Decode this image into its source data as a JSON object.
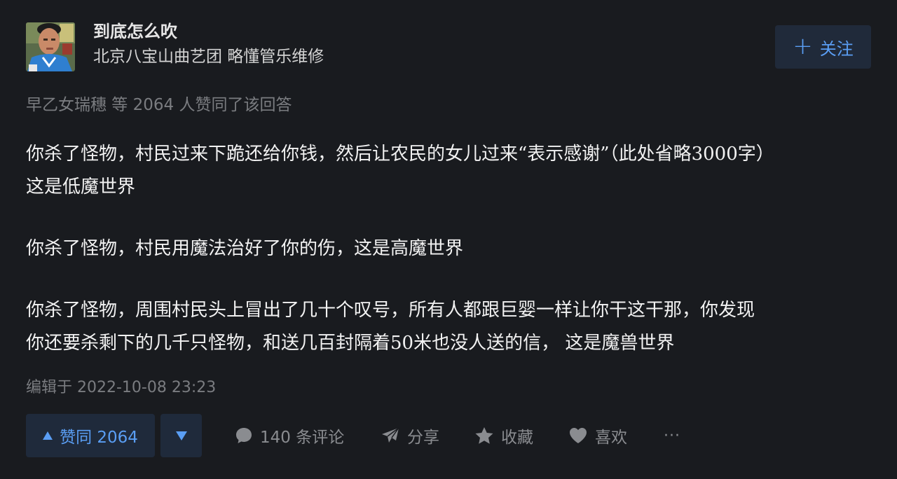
{
  "author": {
    "name": "到底怎么吹",
    "bio": "北京八宝山曲艺团 略懂管乐维修",
    "avatar_icon": "person-avatar"
  },
  "follow": {
    "plus": "+",
    "label": "关注"
  },
  "voters_text": "早乙女瑞穗 等 2064 人赞同了该回答",
  "content": {
    "p1_line1": "你杀了怪物，村民过来下跪还给你钱，然后让农民的女儿过来“表示感谢”（此处省略3000字）",
    "p1_line2": "这是低魔世界",
    "p2": "你杀了怪物，村民用魔法治好了你的伤，这是高魔世界",
    "p3_line1": "你杀了怪物，周围村民头上冒出了几十个叹号，所有人都跟巨婴一样让你干这干那，你发现",
    "p3_line2": "你还要杀剩下的几千只怪物，和送几百封隔着50米也没人送的信， 这是魔兽世界"
  },
  "edited_text": "编辑于 2022-10-08 23:23",
  "actions": {
    "upvote_label": "赞同 2064",
    "comments_label": "140 条评论",
    "share_label": "分享",
    "collect_label": "收藏",
    "like_label": "喜欢",
    "more_label": "···"
  },
  "colors": {
    "background": "#191b1f",
    "accent": "#5a9ef4",
    "muted": "#7a7c80"
  }
}
